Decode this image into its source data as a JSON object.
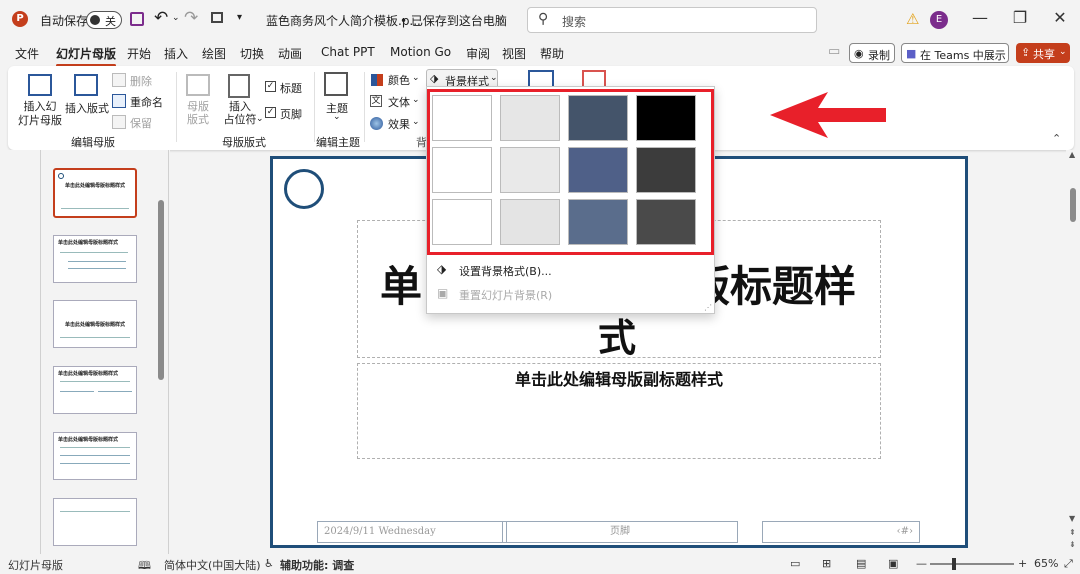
{
  "titlebar": {
    "autosave_label": "自动保存",
    "autosave_state": "关",
    "doc_title": "蓝色商务风个人简介模板.p...",
    "save_status": "• 已保存到这台电脑",
    "search_placeholder": "搜索",
    "user_initial": "E"
  },
  "menu": {
    "tabs": [
      "文件",
      "幻灯片母版",
      "开始",
      "插入",
      "绘图",
      "切换",
      "动画",
      "Chat PPT",
      "Motion Go",
      "审阅",
      "视图",
      "帮助"
    ],
    "active": "幻灯片母版",
    "record_label": "录制",
    "teams_label": "在 Teams 中展示",
    "share_label": "共享"
  },
  "ribbon": {
    "insert_master": "插入幻\n灯片母版",
    "insert_layout": "插入版式",
    "delete": "删除",
    "rename": "重命名",
    "preserve": "保留",
    "master_layout": "母版\n版式",
    "insert_placeholder": "插入\n占位符",
    "title_check": "标题",
    "footer_check": "页脚",
    "theme": "主题",
    "colors": "颜色",
    "fonts": "文体",
    "effects": "效果",
    "background_styles": "背景样式",
    "group_edit_master": "编辑母版",
    "group_master_layout": "母版版式",
    "group_edit_theme": "编辑主题",
    "group_bg_partial": "背"
  },
  "background_dropdown": {
    "swatches": [
      "#ffffff",
      "#e6e6e6",
      "#44546a",
      "#000000",
      "#ffffff",
      "#e9e9e9",
      "#4f6088",
      "#3c3c3c",
      "#ffffff",
      "#e4e4e4",
      "#5a6d8c",
      "#4a4a4a"
    ],
    "format_background": "设置背景格式(B)...",
    "reset_background": "重置幻灯片背景(R)"
  },
  "thumbnails": [
    {
      "title": "单击此处编辑母版标题样式"
    },
    {
      "title": "单击此处编辑母版标题样式"
    },
    {
      "title": "单击此处编辑母版标题样式"
    },
    {
      "title": "单击此处编辑母版标题样式"
    },
    {
      "title": "单击此处编辑母版标题样式"
    },
    {
      "title": ""
    }
  ],
  "slide": {
    "title_left": "单",
    "title_right": "版标题样",
    "title_line2": "式",
    "subtitle": "单击此处编辑母版副标题样式",
    "date": "2024/9/11 Wednesday",
    "footer": "页脚",
    "page_num": "‹#›"
  },
  "statusbar": {
    "view_name": "幻灯片母版",
    "language": "简体中文(中国大陆)",
    "accessibility": "辅助功能: 调查",
    "zoom": "65%"
  },
  "colors": {
    "accent": "#c43e1c",
    "slide_border": "#1f4e79",
    "highlight": "#e8202a"
  }
}
